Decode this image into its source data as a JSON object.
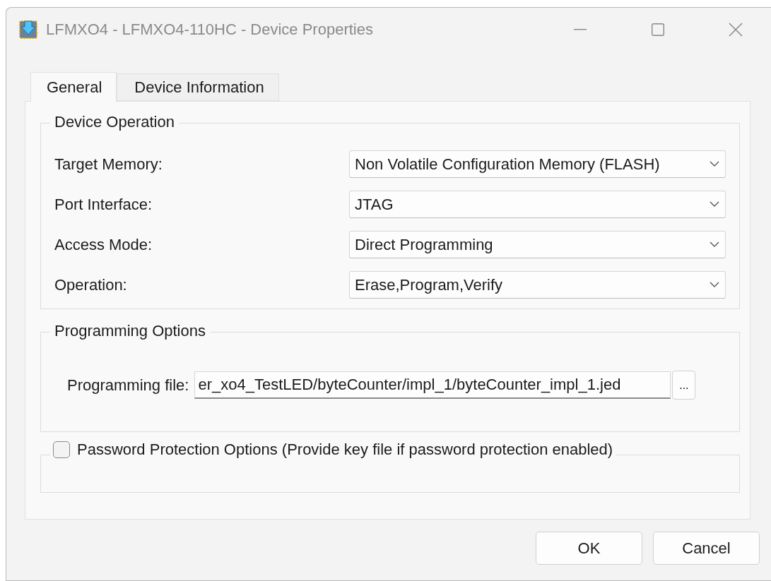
{
  "window": {
    "title": "LFMXO4 - LFMXO4-110HC - Device Properties"
  },
  "tabs": [
    {
      "label": "General",
      "selected": true
    },
    {
      "label": "Device Information",
      "selected": false
    }
  ],
  "device_operation": {
    "title": "Device Operation",
    "fields": [
      {
        "label": "Target Memory:",
        "value": "Non Volatile Configuration Memory (FLASH)"
      },
      {
        "label": "Port Interface:",
        "value": "JTAG"
      },
      {
        "label": "Access Mode:",
        "value": "Direct Programming"
      },
      {
        "label": "Operation:",
        "value": "Erase,Program,Verify"
      }
    ]
  },
  "programming_options": {
    "title": "Programming Options",
    "file_label": "Programming file:",
    "file_value": "er_xo4_TestLED/byteCounter/impl_1/byteCounter_impl_1.jed",
    "browse": "..."
  },
  "password_protection": {
    "label": "Password Protection Options (Provide key file if password protection enabled)",
    "checked": false
  },
  "buttons": [
    "OK",
    "Cancel"
  ]
}
